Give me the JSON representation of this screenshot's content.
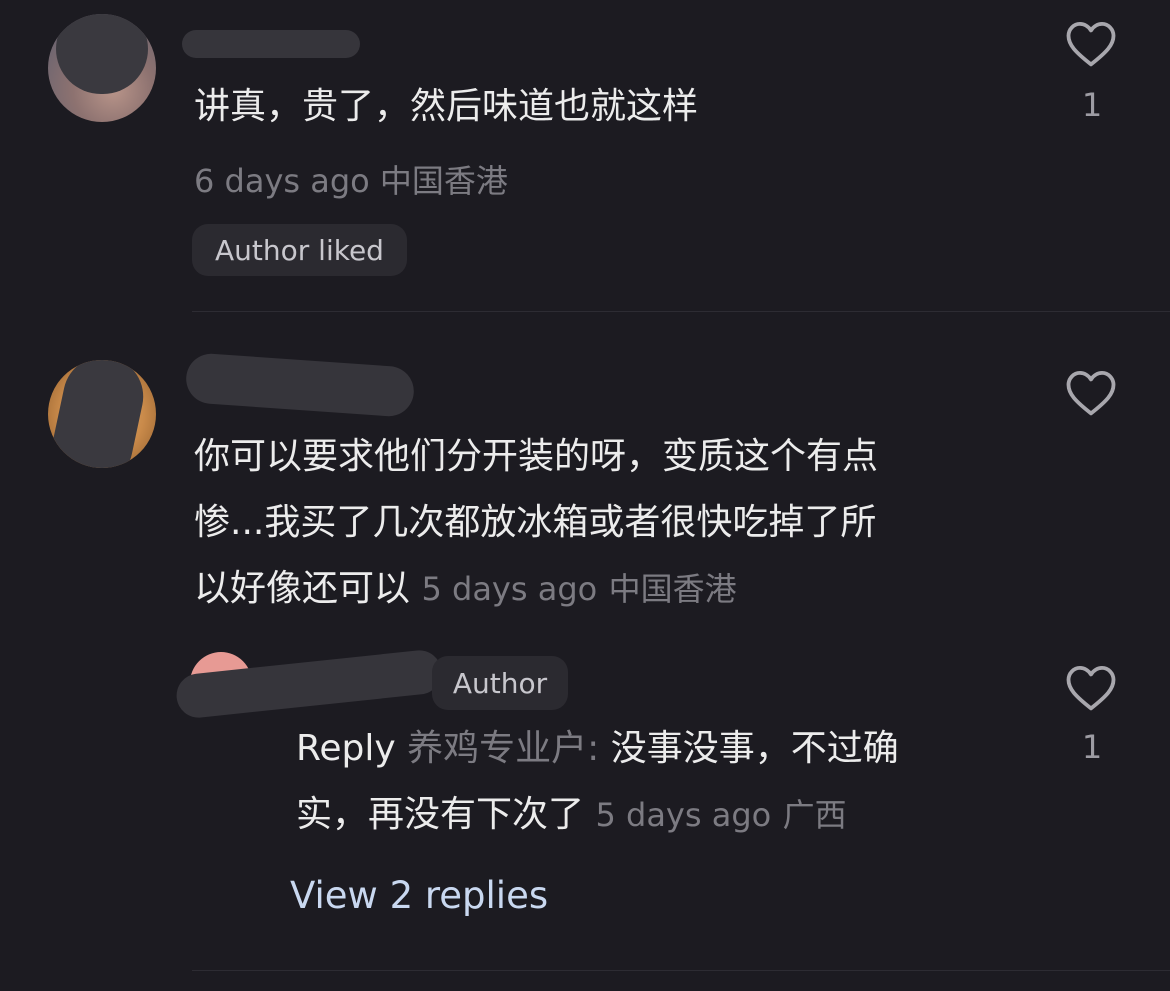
{
  "comments": [
    {
      "text": "讲真，贵了，然后味道也就这样",
      "time": "6 days ago",
      "location": "中国香港",
      "badge": "Author liked",
      "likes": "1"
    },
    {
      "text_lines": [
        "你可以要求他们分开装的呀，变质这个有点",
        "惨...我买了几次都放冰箱或者很快吃掉了所",
        "以好像还可以"
      ],
      "time": "5 days ago",
      "location": "中国香港",
      "likes": "",
      "reply": {
        "author_badge": "Author",
        "reply_word": "Reply",
        "target": "养鸡专业户:",
        "text_line1": "没事没事，不过确",
        "text_line2": "实，再没有下次了",
        "time": "5 days ago",
        "location": "广西",
        "likes": "1"
      },
      "view_replies": "View 2 replies"
    }
  ],
  "icons": {
    "like": "heart-outline-icon"
  },
  "colors": {
    "background": "#1c1b21",
    "text": "#ececec",
    "meta": "#7c7b82",
    "link": "#c9d8f0",
    "badge_bg": "#2b2a30"
  }
}
